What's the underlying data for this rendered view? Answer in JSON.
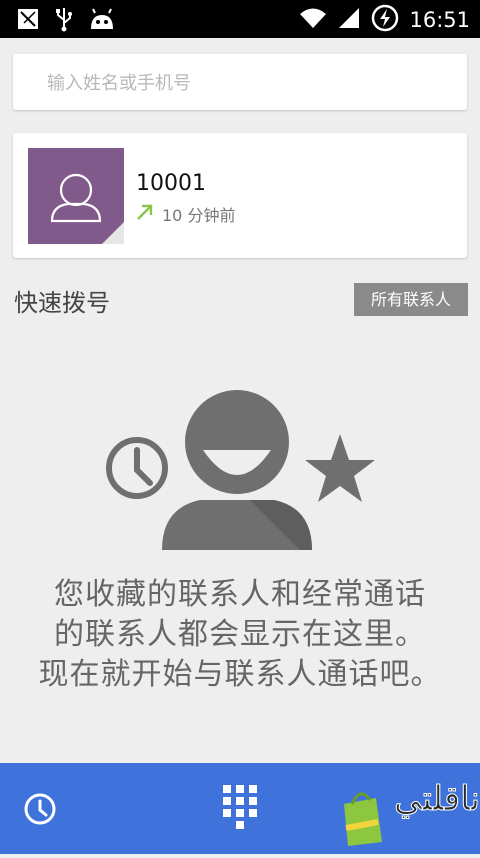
{
  "status_bar": {
    "time": "16:51",
    "left_icons": [
      "no-sim-icon",
      "usb-icon",
      "android-debug-icon"
    ],
    "right_icons": [
      "wifi-icon",
      "signal-icon",
      "battery-charging-icon"
    ]
  },
  "search": {
    "placeholder": "输入姓名或手机号",
    "value": ""
  },
  "recent_call": {
    "number": "10001",
    "time_ago": "10 分钟前",
    "call_type_icon": "outgoing-call-arrow-icon",
    "arrow_color": "#8bc34a",
    "avatar_color": "#7f5a8b"
  },
  "speed_dial": {
    "title": "快速拨号",
    "all_contacts_label": "所有联系人"
  },
  "empty_state": {
    "icons": [
      "clock-icon",
      "person-icon",
      "star-icon"
    ],
    "lines": [
      "您收藏的联系人和经常通话",
      "的联系人都会显示在这里。",
      "现在就开始与联系人通话吧。"
    ]
  },
  "bottom_bar": {
    "color": "#3f73db",
    "tabs": [
      "recent-calls-icon",
      "dialpad-icon"
    ]
  },
  "watermark": {
    "text": "ناقلتي"
  }
}
